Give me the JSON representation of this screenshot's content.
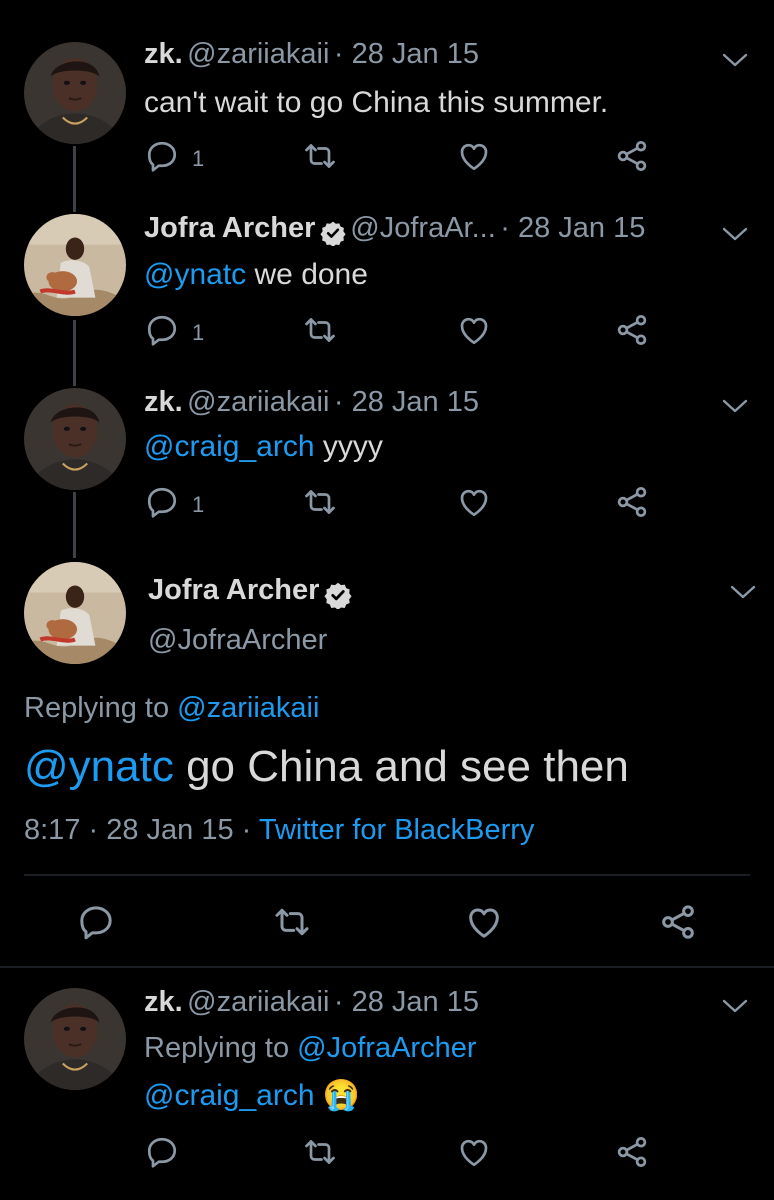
{
  "tweets": [
    {
      "display_name": "zk.",
      "handle": "@zariiakaii",
      "date": "· 28 Jan 15",
      "text": "can't wait to go China this summer.",
      "reply_count": "1"
    },
    {
      "display_name": "Jofra Archer",
      "handle": "@JofraAr...",
      "date": "· 28 Jan 15",
      "mention": "@ynatc",
      "text": " we done",
      "reply_count": "1"
    },
    {
      "display_name": "zk.",
      "handle": "@zariiakaii",
      "date": "· 28 Jan 15",
      "mention": "@craig_arch",
      "text": " yyyy",
      "reply_count": "1"
    }
  ],
  "focused": {
    "display_name": "Jofra Archer",
    "handle": "@JofraArcher",
    "replying_prefix": "Replying to ",
    "replying_to": "@zariiakaii",
    "mention": "@ynatc",
    "text": " go China and see then",
    "time": "8:17 · 28 Jan 15 · ",
    "source": "Twitter for BlackBerry"
  },
  "reply": {
    "display_name": "zk.",
    "handle": "@zariiakaii",
    "date": "· 28 Jan 15",
    "replying_prefix": "Replying to ",
    "replying_to": "@JofraArcher",
    "mention": "@craig_arch",
    "emoji": "😭"
  },
  "colors": {
    "background": "#000000",
    "link": "#1d9bf0",
    "muted": "#8b98a5",
    "text": "#d9d9d9"
  },
  "icons": [
    "reply-icon",
    "retweet-icon",
    "like-icon",
    "share-icon",
    "chevron-down-icon",
    "verified-badge-icon"
  ]
}
